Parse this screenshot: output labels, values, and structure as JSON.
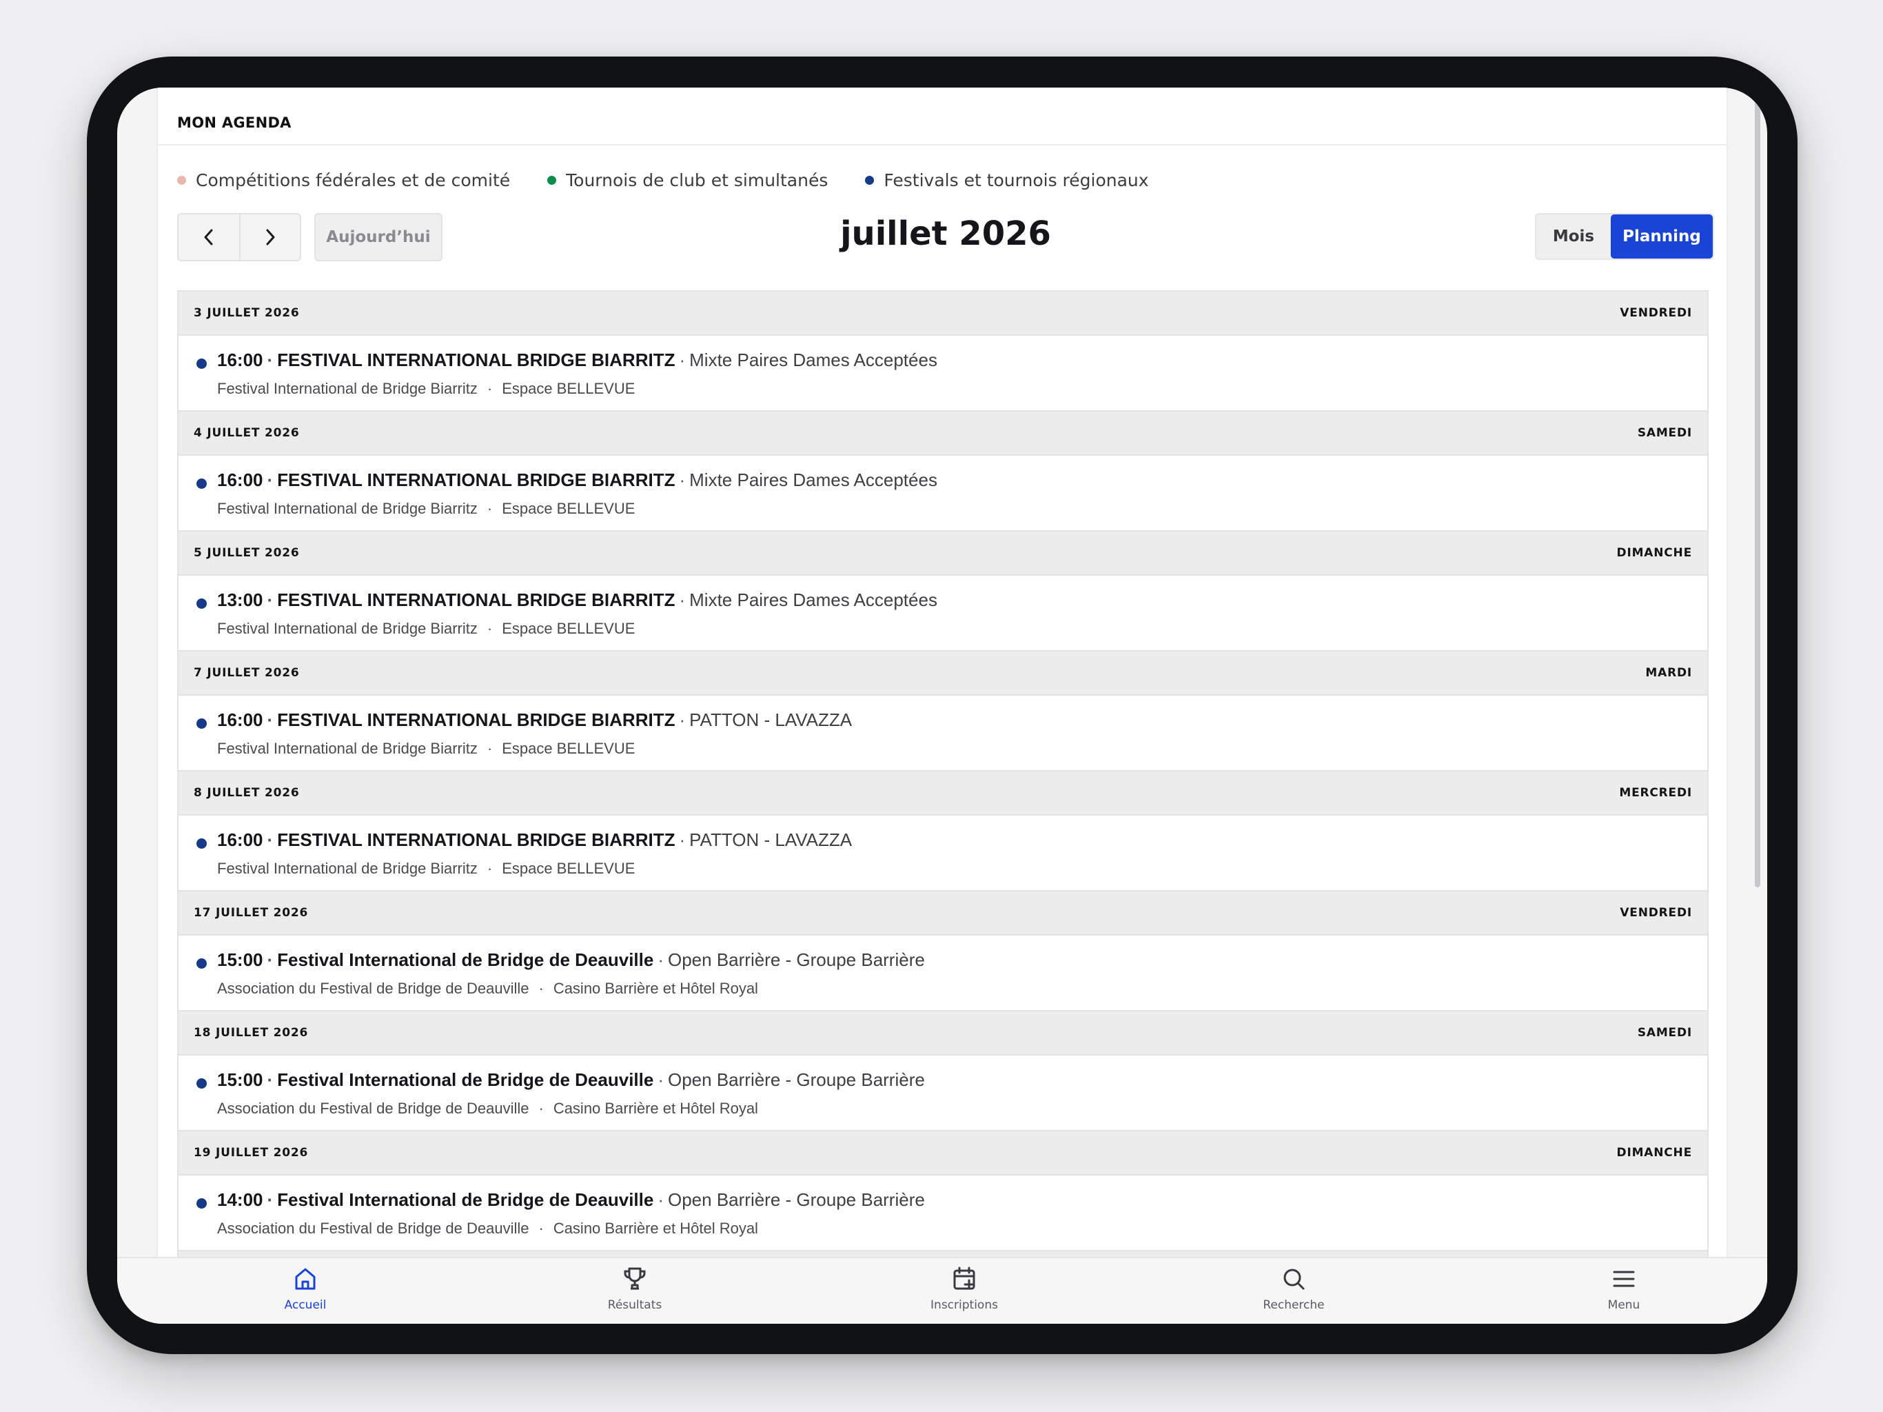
{
  "header": {
    "title": "MON AGENDA"
  },
  "legend": [
    {
      "label": "Compétitions fédérales et de comité",
      "color": "#e9b8ac"
    },
    {
      "label": "Tournois de club et simultanés",
      "color": "#0a8f4a"
    },
    {
      "label": "Festivals et tournois régionaux",
      "color": "#163a87"
    }
  ],
  "toolbar": {
    "prev_icon": "chevron-left-icon",
    "next_icon": "chevron-right-icon",
    "today_label": "Aujourd’hui",
    "period_title": "juillet 2026",
    "view_month_label": "Mois",
    "view_planning_label": "Planning",
    "active_view": "Planning",
    "accent": "#1a44d6"
  },
  "days": [
    {
      "date": "3 JUILLET 2026",
      "weekday": "VENDREDI",
      "events": [
        {
          "time": "16:00",
          "title": "FESTIVAL INTERNATIONAL BRIDGE BIARRITZ",
          "subtitle": "Mixte Paires Dames Acceptées",
          "organizer": "Festival International de Bridge Biarritz",
          "venue": "Espace BELLEVUE"
        }
      ]
    },
    {
      "date": "4 JUILLET 2026",
      "weekday": "SAMEDI",
      "events": [
        {
          "time": "16:00",
          "title": "FESTIVAL INTERNATIONAL BRIDGE BIARRITZ",
          "subtitle": "Mixte Paires Dames Acceptées",
          "organizer": "Festival International de Bridge Biarritz",
          "venue": "Espace BELLEVUE"
        }
      ]
    },
    {
      "date": "5 JUILLET 2026",
      "weekday": "DIMANCHE",
      "events": [
        {
          "time": "13:00",
          "title": "FESTIVAL INTERNATIONAL BRIDGE BIARRITZ",
          "subtitle": "Mixte Paires Dames Acceptées",
          "organizer": "Festival International de Bridge Biarritz",
          "venue": "Espace BELLEVUE"
        }
      ]
    },
    {
      "date": "7 JUILLET 2026",
      "weekday": "MARDI",
      "events": [
        {
          "time": "16:00",
          "title": "FESTIVAL INTERNATIONAL BRIDGE BIARRITZ",
          "subtitle": "PATTON - LAVAZZA",
          "organizer": "Festival International de Bridge Biarritz",
          "venue": "Espace BELLEVUE"
        }
      ]
    },
    {
      "date": "8 JUILLET 2026",
      "weekday": "MERCREDI",
      "events": [
        {
          "time": "16:00",
          "title": "FESTIVAL INTERNATIONAL BRIDGE BIARRITZ",
          "subtitle": "PATTON - LAVAZZA",
          "organizer": "Festival International de Bridge Biarritz",
          "venue": "Espace BELLEVUE"
        }
      ]
    },
    {
      "date": "17 JUILLET 2026",
      "weekday": "VENDREDI",
      "events": [
        {
          "time": "15:00",
          "title": "Festival International de Bridge de Deauville",
          "subtitle": "Open Barrière - Groupe Barrière",
          "organizer": "Association du Festival de Bridge de Deauville",
          "venue": "Casino Barrière et Hôtel Royal"
        }
      ]
    },
    {
      "date": "18 JUILLET 2026",
      "weekday": "SAMEDI",
      "events": [
        {
          "time": "15:00",
          "title": "Festival International de Bridge de Deauville",
          "subtitle": "Open Barrière - Groupe Barrière",
          "organizer": "Association du Festival de Bridge de Deauville",
          "venue": "Casino Barrière et Hôtel Royal"
        }
      ]
    },
    {
      "date": "19 JUILLET 2026",
      "weekday": "DIMANCHE",
      "events": [
        {
          "time": "14:00",
          "title": "Festival International de Bridge de Deauville",
          "subtitle": "Open Barrière - Groupe Barrière",
          "organizer": "Association du Festival de Bridge de Deauville",
          "venue": "Casino Barrière et Hôtel Royal"
        }
      ]
    }
  ],
  "tabbar": [
    {
      "label": "Accueil",
      "icon": "home-icon",
      "active": true
    },
    {
      "label": "Résultats",
      "icon": "trophy-icon",
      "active": false
    },
    {
      "label": "Inscriptions",
      "icon": "calendar-plus-icon",
      "active": false
    },
    {
      "label": "Recherche",
      "icon": "search-icon",
      "active": false
    },
    {
      "label": "Menu",
      "icon": "menu-icon",
      "active": false
    }
  ]
}
